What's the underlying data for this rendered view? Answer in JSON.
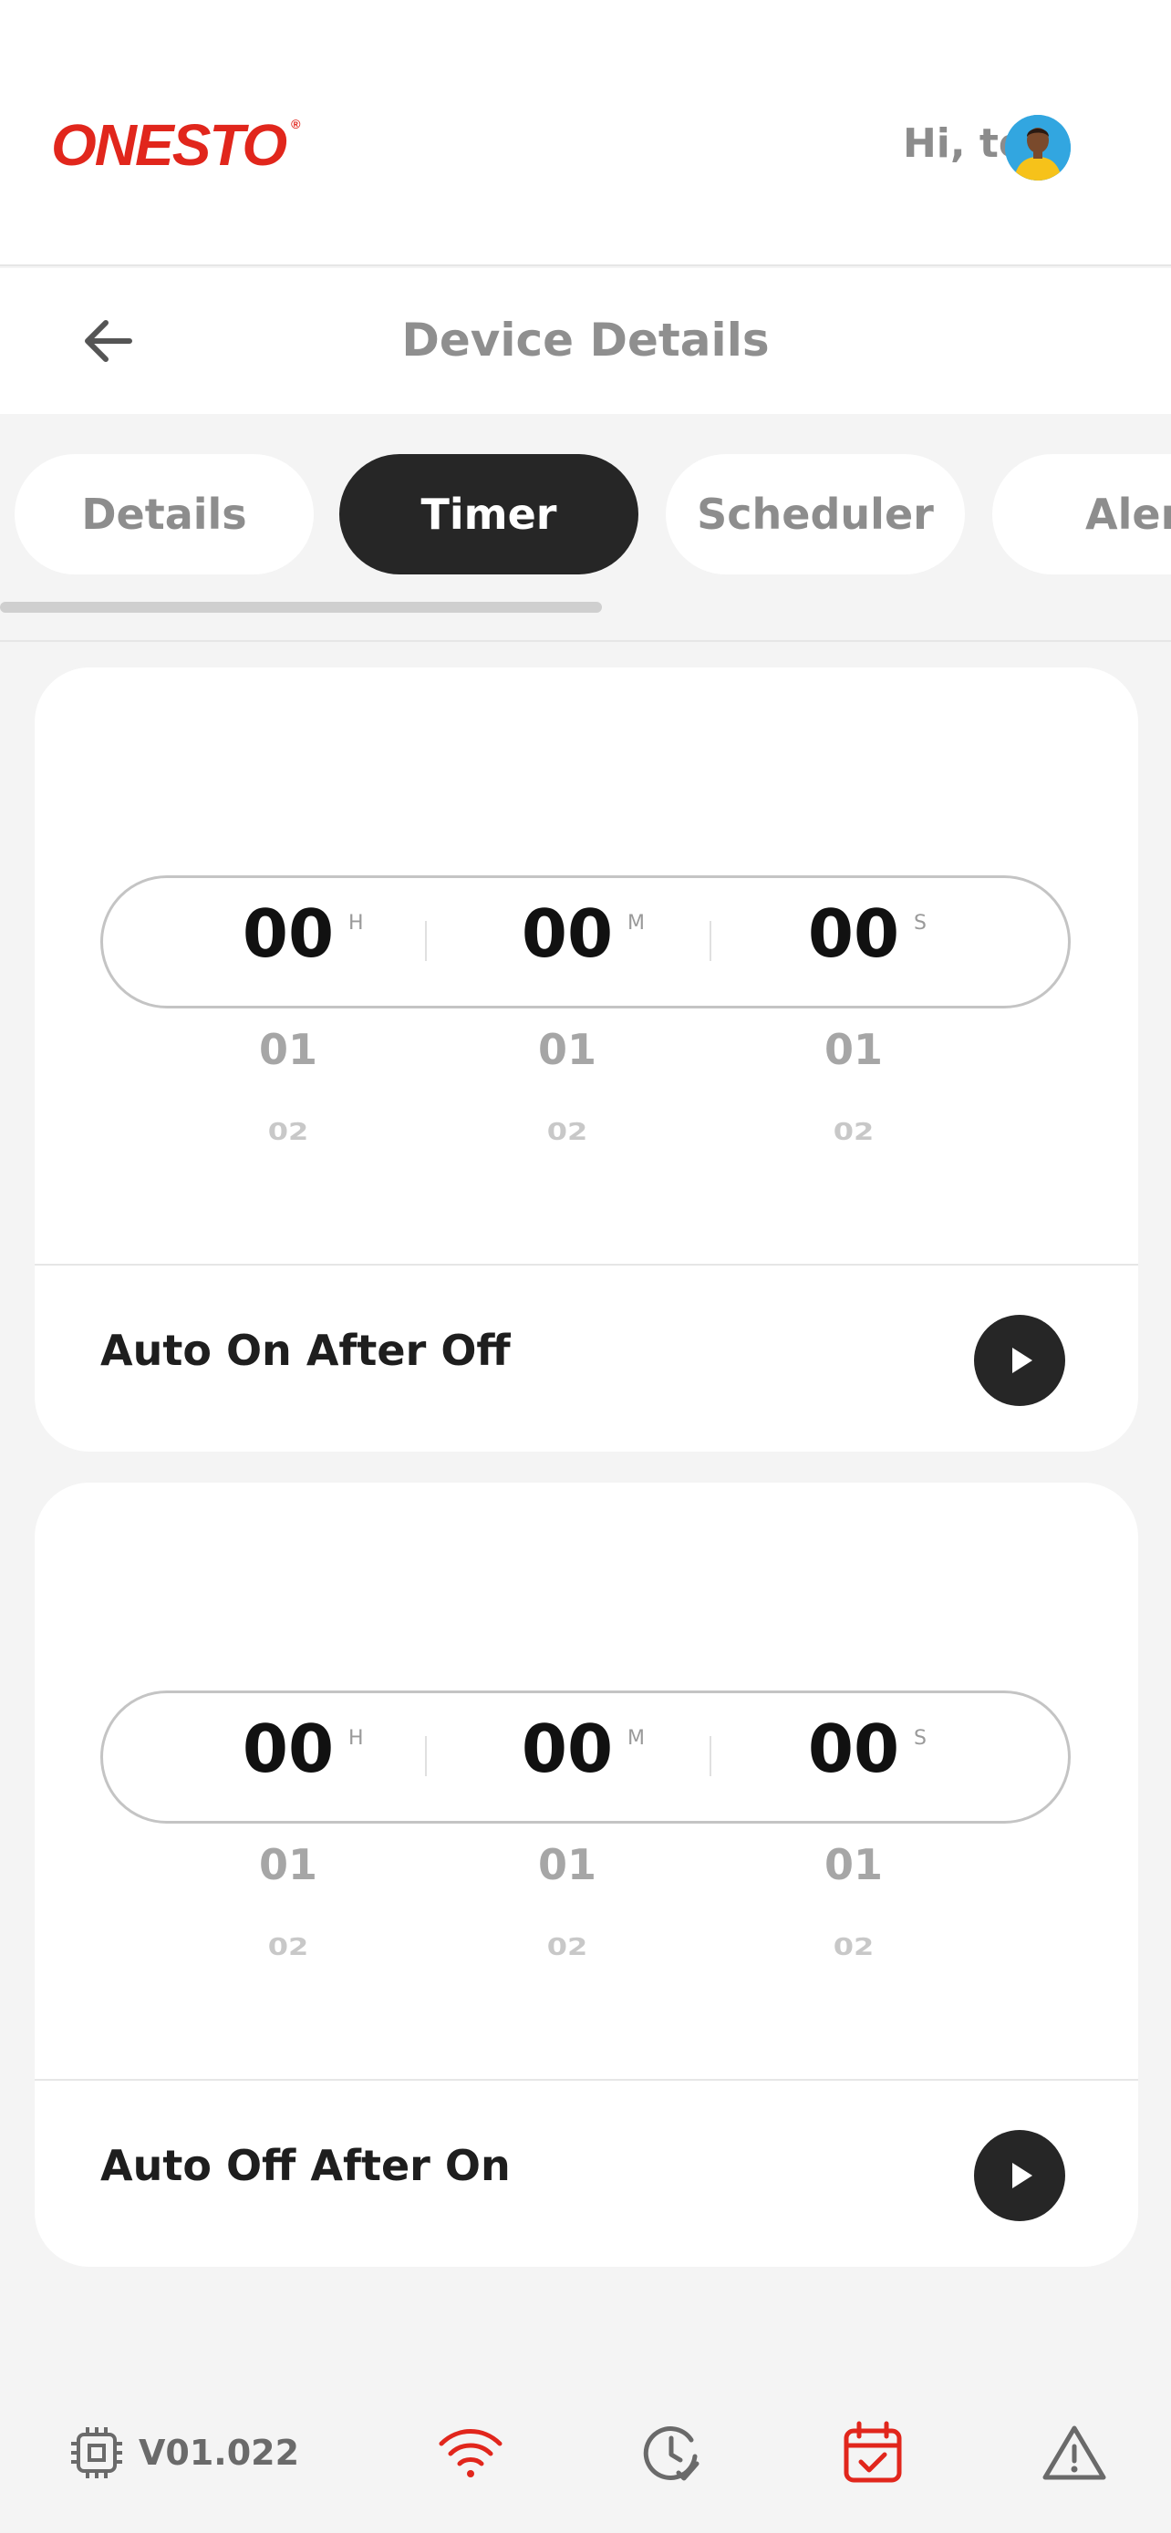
{
  "brand": {
    "logo_text": "ONESTO",
    "registered_mark": "®",
    "color": "#e1261c"
  },
  "user": {
    "greeting": "Hi, test"
  },
  "header": {
    "title": "Device Details"
  },
  "tabs": [
    {
      "label": "Details",
      "active": false
    },
    {
      "label": "Timer",
      "active": true
    },
    {
      "label": "Scheduler",
      "active": false
    },
    {
      "label": "Aler",
      "active": false
    }
  ],
  "timers": [
    {
      "label": "Auto On After Off",
      "selected": {
        "hours": "00",
        "minutes": "00",
        "seconds": "00"
      },
      "units": {
        "hours": "H",
        "minutes": "M",
        "seconds": "S"
      },
      "next_values": [
        "01",
        "01",
        "01"
      ],
      "after_next_values": [
        "02",
        "02",
        "02"
      ]
    },
    {
      "label": "Auto Off After On",
      "selected": {
        "hours": "00",
        "minutes": "00",
        "seconds": "00"
      },
      "units": {
        "hours": "H",
        "minutes": "M",
        "seconds": "S"
      },
      "next_values": [
        "01",
        "01",
        "01"
      ],
      "after_next_values": [
        "02",
        "02",
        "02"
      ]
    }
  ],
  "bottom_nav": {
    "version": "V01.022",
    "items": [
      "chip-icon",
      "wifi-icon",
      "clock-check-icon",
      "calendar-check-icon",
      "warning-icon"
    ]
  },
  "colors": {
    "accent_red": "#e1261c",
    "dark": "#262626",
    "muted": "#8d8d8d"
  }
}
